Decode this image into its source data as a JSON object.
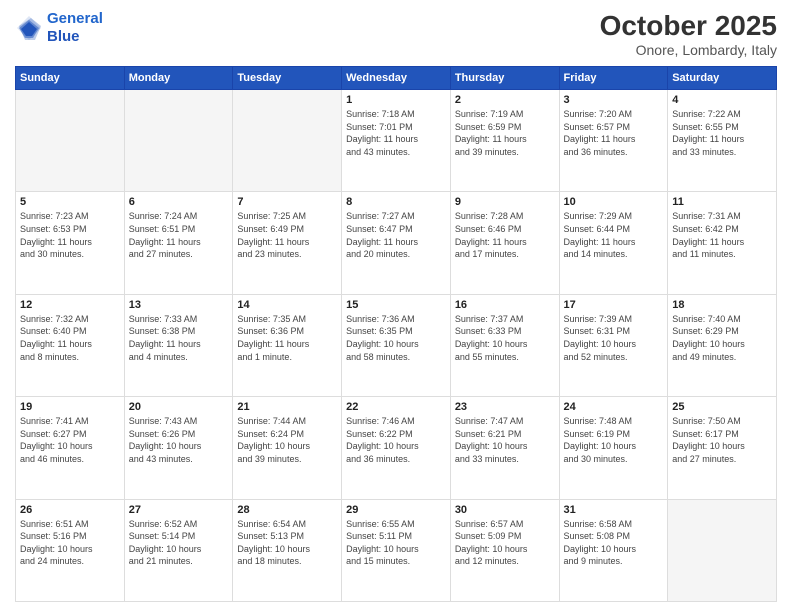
{
  "header": {
    "logo_line1": "General",
    "logo_line2": "Blue",
    "month": "October 2025",
    "location": "Onore, Lombardy, Italy"
  },
  "weekdays": [
    "Sunday",
    "Monday",
    "Tuesday",
    "Wednesday",
    "Thursday",
    "Friday",
    "Saturday"
  ],
  "weeks": [
    [
      {
        "day": "",
        "info": ""
      },
      {
        "day": "",
        "info": ""
      },
      {
        "day": "",
        "info": ""
      },
      {
        "day": "1",
        "info": "Sunrise: 7:18 AM\nSunset: 7:01 PM\nDaylight: 11 hours\nand 43 minutes."
      },
      {
        "day": "2",
        "info": "Sunrise: 7:19 AM\nSunset: 6:59 PM\nDaylight: 11 hours\nand 39 minutes."
      },
      {
        "day": "3",
        "info": "Sunrise: 7:20 AM\nSunset: 6:57 PM\nDaylight: 11 hours\nand 36 minutes."
      },
      {
        "day": "4",
        "info": "Sunrise: 7:22 AM\nSunset: 6:55 PM\nDaylight: 11 hours\nand 33 minutes."
      }
    ],
    [
      {
        "day": "5",
        "info": "Sunrise: 7:23 AM\nSunset: 6:53 PM\nDaylight: 11 hours\nand 30 minutes."
      },
      {
        "day": "6",
        "info": "Sunrise: 7:24 AM\nSunset: 6:51 PM\nDaylight: 11 hours\nand 27 minutes."
      },
      {
        "day": "7",
        "info": "Sunrise: 7:25 AM\nSunset: 6:49 PM\nDaylight: 11 hours\nand 23 minutes."
      },
      {
        "day": "8",
        "info": "Sunrise: 7:27 AM\nSunset: 6:47 PM\nDaylight: 11 hours\nand 20 minutes."
      },
      {
        "day": "9",
        "info": "Sunrise: 7:28 AM\nSunset: 6:46 PM\nDaylight: 11 hours\nand 17 minutes."
      },
      {
        "day": "10",
        "info": "Sunrise: 7:29 AM\nSunset: 6:44 PM\nDaylight: 11 hours\nand 14 minutes."
      },
      {
        "day": "11",
        "info": "Sunrise: 7:31 AM\nSunset: 6:42 PM\nDaylight: 11 hours\nand 11 minutes."
      }
    ],
    [
      {
        "day": "12",
        "info": "Sunrise: 7:32 AM\nSunset: 6:40 PM\nDaylight: 11 hours\nand 8 minutes."
      },
      {
        "day": "13",
        "info": "Sunrise: 7:33 AM\nSunset: 6:38 PM\nDaylight: 11 hours\nand 4 minutes."
      },
      {
        "day": "14",
        "info": "Sunrise: 7:35 AM\nSunset: 6:36 PM\nDaylight: 11 hours\nand 1 minute."
      },
      {
        "day": "15",
        "info": "Sunrise: 7:36 AM\nSunset: 6:35 PM\nDaylight: 10 hours\nand 58 minutes."
      },
      {
        "day": "16",
        "info": "Sunrise: 7:37 AM\nSunset: 6:33 PM\nDaylight: 10 hours\nand 55 minutes."
      },
      {
        "day": "17",
        "info": "Sunrise: 7:39 AM\nSunset: 6:31 PM\nDaylight: 10 hours\nand 52 minutes."
      },
      {
        "day": "18",
        "info": "Sunrise: 7:40 AM\nSunset: 6:29 PM\nDaylight: 10 hours\nand 49 minutes."
      }
    ],
    [
      {
        "day": "19",
        "info": "Sunrise: 7:41 AM\nSunset: 6:27 PM\nDaylight: 10 hours\nand 46 minutes."
      },
      {
        "day": "20",
        "info": "Sunrise: 7:43 AM\nSunset: 6:26 PM\nDaylight: 10 hours\nand 43 minutes."
      },
      {
        "day": "21",
        "info": "Sunrise: 7:44 AM\nSunset: 6:24 PM\nDaylight: 10 hours\nand 39 minutes."
      },
      {
        "day": "22",
        "info": "Sunrise: 7:46 AM\nSunset: 6:22 PM\nDaylight: 10 hours\nand 36 minutes."
      },
      {
        "day": "23",
        "info": "Sunrise: 7:47 AM\nSunset: 6:21 PM\nDaylight: 10 hours\nand 33 minutes."
      },
      {
        "day": "24",
        "info": "Sunrise: 7:48 AM\nSunset: 6:19 PM\nDaylight: 10 hours\nand 30 minutes."
      },
      {
        "day": "25",
        "info": "Sunrise: 7:50 AM\nSunset: 6:17 PM\nDaylight: 10 hours\nand 27 minutes."
      }
    ],
    [
      {
        "day": "26",
        "info": "Sunrise: 6:51 AM\nSunset: 5:16 PM\nDaylight: 10 hours\nand 24 minutes."
      },
      {
        "day": "27",
        "info": "Sunrise: 6:52 AM\nSunset: 5:14 PM\nDaylight: 10 hours\nand 21 minutes."
      },
      {
        "day": "28",
        "info": "Sunrise: 6:54 AM\nSunset: 5:13 PM\nDaylight: 10 hours\nand 18 minutes."
      },
      {
        "day": "29",
        "info": "Sunrise: 6:55 AM\nSunset: 5:11 PM\nDaylight: 10 hours\nand 15 minutes."
      },
      {
        "day": "30",
        "info": "Sunrise: 6:57 AM\nSunset: 5:09 PM\nDaylight: 10 hours\nand 12 minutes."
      },
      {
        "day": "31",
        "info": "Sunrise: 6:58 AM\nSunset: 5:08 PM\nDaylight: 10 hours\nand 9 minutes."
      },
      {
        "day": "",
        "info": ""
      }
    ]
  ]
}
